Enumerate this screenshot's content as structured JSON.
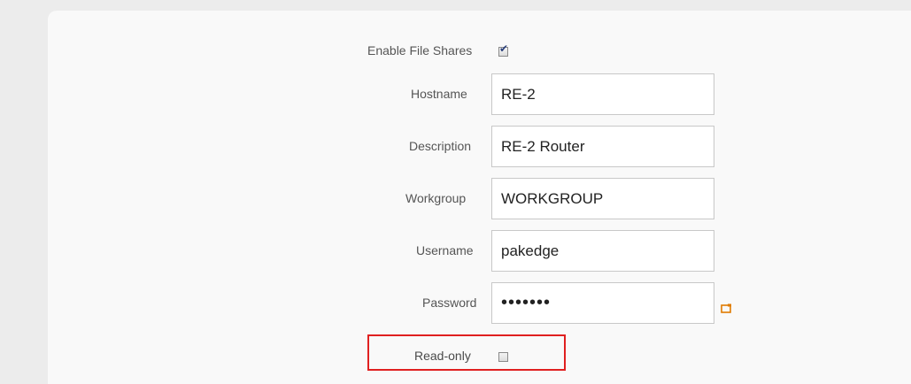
{
  "form": {
    "enable_file_shares": {
      "label": "Enable File Shares",
      "checked": true
    },
    "hostname": {
      "label": "Hostname",
      "value": "RE-2"
    },
    "description": {
      "label": "Description",
      "value": "RE-2 Router"
    },
    "workgroup": {
      "label": "Workgroup",
      "value": "WORKGROUP"
    },
    "username": {
      "label": "Username",
      "value": "pakedge"
    },
    "password": {
      "label": "Password",
      "value": "•••••••",
      "reveal_icon": "show-password-icon",
      "reveal_icon_color": "#e07b00"
    },
    "read_only": {
      "label": "Read-only",
      "checked": false,
      "highlight_color": "#e02020"
    }
  }
}
